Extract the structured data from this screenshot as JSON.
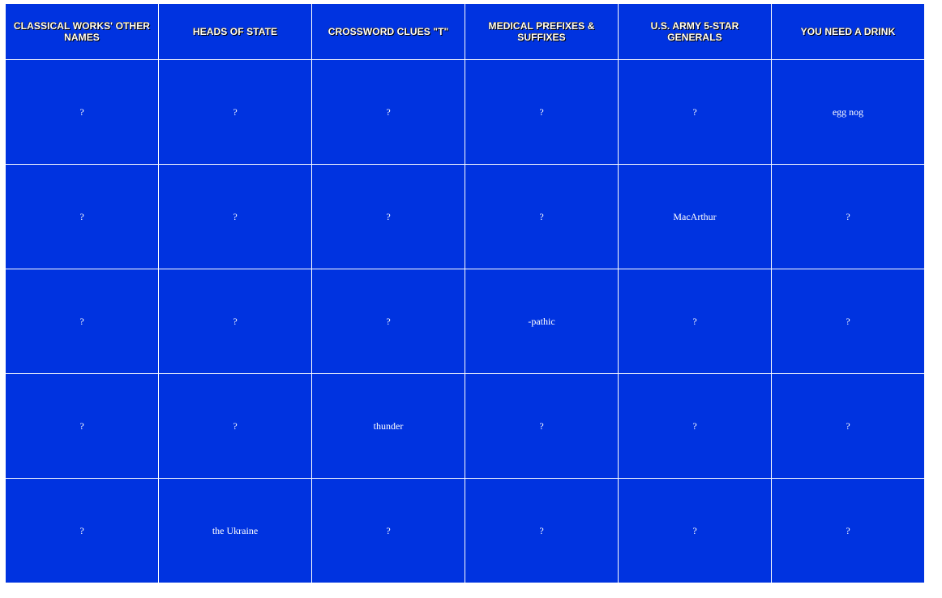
{
  "board": {
    "categories": [
      "Classical Works' Other Names",
      "Heads of State",
      "Crossword Clues \"T\"",
      "Medical Prefixes & Suffixes",
      "U.S. Army 5-Star Generals",
      "You Need A Drink"
    ],
    "rows": [
      [
        "?",
        "?",
        "?",
        "?",
        "?",
        "egg nog"
      ],
      [
        "?",
        "?",
        "?",
        "?",
        "MacArthur",
        "?"
      ],
      [
        "?",
        "?",
        "?",
        "-pathic",
        "?",
        "?"
      ],
      [
        "?",
        "?",
        "thunder",
        "?",
        "?",
        "?"
      ],
      [
        "?",
        "the Ukraine",
        "?",
        "?",
        "?",
        "?"
      ]
    ]
  },
  "colors": {
    "board_background": "#0033e0",
    "text": "#ffffff",
    "grid_lines": "#ffffff"
  }
}
